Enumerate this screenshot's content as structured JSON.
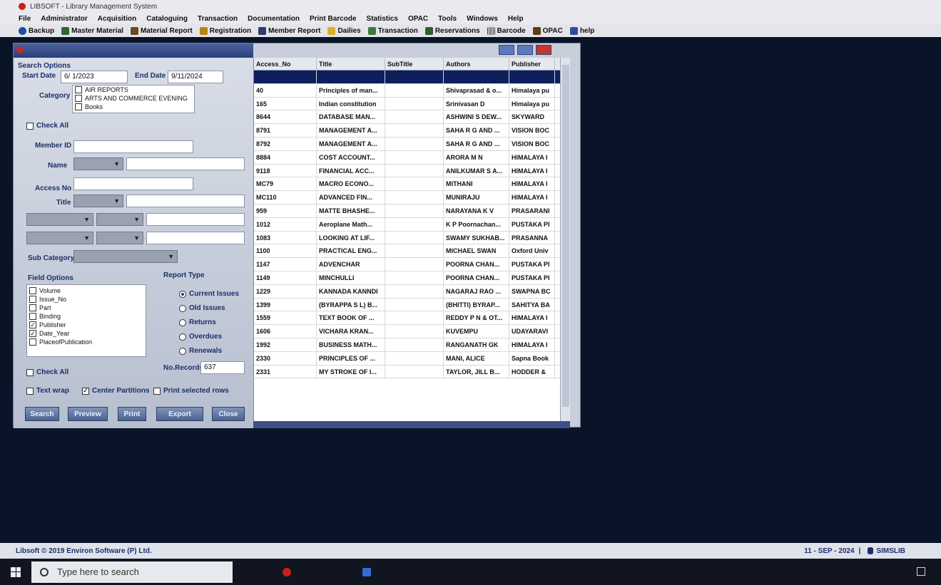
{
  "window": {
    "title": "LIBSOFT - Library Management System"
  },
  "menu": [
    "File",
    "Administrator",
    "Acquisition",
    "Cataloguing",
    "Transaction",
    "Documentation",
    "Print Barcode",
    "Statistics",
    "OPAC",
    "Tools",
    "Windows",
    "Help"
  ],
  "toolbar": [
    {
      "label": "Backup",
      "icon": "backup-icon",
      "color": "#1b4fa0"
    },
    {
      "label": "Master Material",
      "icon": "books-icon",
      "color": "#2b6a2b"
    },
    {
      "label": "Material Report",
      "icon": "report-icon",
      "color": "#6a4b1b"
    },
    {
      "label": "Registration",
      "icon": "registration-icon",
      "color": "#b8860b"
    },
    {
      "label": "Member Report",
      "icon": "member-icon",
      "color": "#2c3f6b"
    },
    {
      "label": "Dailies",
      "icon": "dailies-icon",
      "color": "#d6b02a"
    },
    {
      "label": "Transaction",
      "icon": "transaction-icon",
      "color": "#3a7a3a"
    },
    {
      "label": "Reservations",
      "icon": "reservations-icon",
      "color": "#2f5f2f"
    },
    {
      "label": "Barcode",
      "icon": "barcode-icon",
      "color": "#333333"
    },
    {
      "label": "OPAC",
      "icon": "opac-icon",
      "color": "#5d3c1b"
    },
    {
      "label": "help",
      "icon": "help-icon",
      "color": "#2b4e9b"
    }
  ],
  "form": {
    "search_options_label": "Search Options",
    "start_date_label": "Start Date",
    "start_date_value": "6/ 1/2023",
    "end_date_label": "End Date",
    "end_date_value": "9/11/2024",
    "category_label": "Category",
    "categories": [
      "AIR REPORTS",
      "ARTS AND COMMERCE EVENING",
      "Books"
    ],
    "check_all_label": "Check All",
    "member_id_label": "Member ID",
    "name_label": "Name",
    "access_no_label": "Access No",
    "title_label": "Title",
    "sub_category_label": "Sub Category",
    "field_options_label": "Field Options",
    "field_options": [
      {
        "label": "Volume",
        "checked": false
      },
      {
        "label": "Issue_No",
        "checked": false
      },
      {
        "label": "Part",
        "checked": false
      },
      {
        "label": "Binding",
        "checked": false
      },
      {
        "label": "Publisher",
        "checked": true
      },
      {
        "label": "Date_Year",
        "checked": true
      },
      {
        "label": "PlaceofPublication",
        "checked": false
      }
    ],
    "check_all2_label": "Check All",
    "report_type_label": "Report Type",
    "report_types": [
      {
        "label": "Current Issues",
        "selected": true
      },
      {
        "label": "Old Issues",
        "selected": false
      },
      {
        "label": "Returns",
        "selected": false
      },
      {
        "label": "Overdues",
        "selected": false
      },
      {
        "label": "Renewals",
        "selected": false
      }
    ],
    "no_records_label": "No.Records",
    "no_records_value": "637",
    "text_wrap_label": "Text wrap",
    "center_partitions_label": "Center Partitions",
    "print_selected_label": "Print selected rows",
    "buttons": [
      "Search",
      "Preview",
      "Print",
      "Export",
      "Close"
    ]
  },
  "grid": {
    "columns": [
      "Access_No",
      "Title",
      "SubTitle",
      "Authors",
      "Publisher"
    ],
    "rows": [
      [
        "",
        "",
        "",
        "",
        ""
      ],
      [
        "40",
        "Principles of man...",
        "",
        "Shivaprasad & o...",
        "Himalaya pu"
      ],
      [
        "165",
        "Indian constitution",
        "",
        "Srinivasan D",
        "Himalaya pu"
      ],
      [
        "8644",
        "DATABASE MAN...",
        "",
        "ASHWINI S DEW...",
        "SKYWARD"
      ],
      [
        "8791",
        "MANAGEMENT A...",
        "",
        "SAHA R G AND ...",
        "VISION BOC"
      ],
      [
        "8792",
        "MANAGEMENT A...",
        "",
        "SAHA R G AND ...",
        "VISION BOC"
      ],
      [
        "8884",
        "COST ACCOUNT...",
        "",
        "ARORA M N",
        "HIMALAYA I"
      ],
      [
        "9118",
        "FINANCIAL ACC...",
        "",
        "ANILKUMAR S A...",
        "HIMALAYA I"
      ],
      [
        "MC79",
        "MACRO ECONO...",
        "",
        "MITHANI",
        "HIMALAYA I"
      ],
      [
        "MC110",
        "ADVANCED FIN...",
        "",
        "MUNIRAJU",
        "HIMALAYA I"
      ],
      [
        "959",
        "MATTE BHASHE...",
        "",
        "NARAYANA K V",
        "PRASARANI"
      ],
      [
        "1012",
        "Aeroplane Math...",
        "",
        "K P Poornachan...",
        "PUSTAKA PI"
      ],
      [
        "1083",
        "LOOKING AT LIF...",
        "",
        "SWAMY SUKHAB...",
        "PRASANNA"
      ],
      [
        "1100",
        "PRACTICAL ENG...",
        "",
        "MICHAEL SWAN",
        "Oxford Univ"
      ],
      [
        "1147",
        "ADVENCHAR",
        "",
        "POORNA CHAN...",
        "PUSTAKA PI"
      ],
      [
        "1149",
        "MINCHULLI",
        "",
        "POORNA CHAN...",
        "PUSTAKA PI"
      ],
      [
        "1229",
        "KANNADA KANNDI",
        "",
        "NAGARAJ RAO ...",
        "SWAPNA BC"
      ],
      [
        "1399",
        "(BYRAPPA S L) B...",
        "",
        "(BHITTI) BYRAP...",
        "SAHITYA BA"
      ],
      [
        "1559",
        "TEXT BOOK OF ...",
        "",
        "REDDY P N & OT...",
        "HIMALAYA I"
      ],
      [
        "1606",
        "VICHARA KRAN...",
        "",
        "KUVEMPU",
        "UDAYARAVI"
      ],
      [
        "1992",
        "BUSINESS MATH...",
        "",
        "RANGANATH GK",
        "HIMALAYA I"
      ],
      [
        "2330",
        "PRINCIPLES OF ...",
        "",
        "MANI, ALICE",
        "Sapna Book"
      ],
      [
        "2331",
        "MY STROKE OF I...",
        "",
        "TAYLOR, JILL B...",
        "HODDER &"
      ]
    ]
  },
  "status": {
    "copyright": "Libsoft © 2019 Environ Software (P) Ltd.",
    "date": "11 - SEP - 2024",
    "separator": "|",
    "db_name": "SIMSLIB"
  },
  "taskbar": {
    "search_placeholder": "Type here to search"
  }
}
